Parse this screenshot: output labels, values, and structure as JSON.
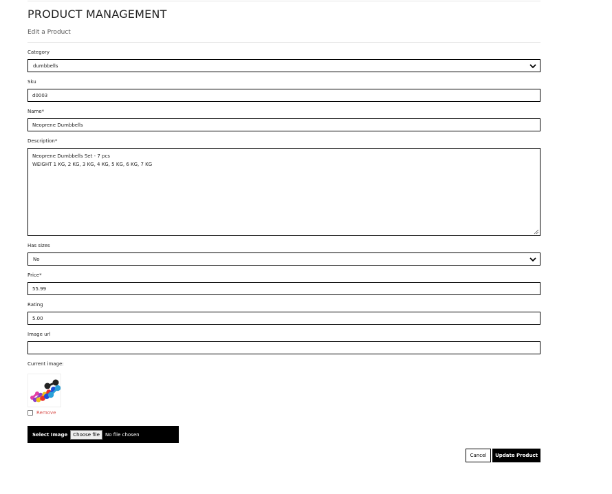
{
  "page": {
    "title": "PRODUCT MANAGEMENT",
    "subtitle": "Edit a Product"
  },
  "form": {
    "category": {
      "label": "Category",
      "value": "dumbbells"
    },
    "sku": {
      "label": "Sku",
      "value": "d0003"
    },
    "name": {
      "label": "Name*",
      "value": "Neoprene Dumbbells"
    },
    "description": {
      "label": "Description*",
      "line1": "Neoprene Dumbbells Set - 7 pcs",
      "line2": "WEIGHT 1 KG, 2 KG, 3 KG, 4 KG, 5 KG, 6 KG, 7 KG"
    },
    "has_sizes": {
      "label": "Has sizes",
      "value": "No"
    },
    "price": {
      "label": "Price*",
      "value": "55.99"
    },
    "rating": {
      "label": "Rating",
      "value": "5.00"
    },
    "image_url": {
      "label": "Image url",
      "value": ""
    },
    "current_image": {
      "label": "Current image:",
      "remove_label": "Remove"
    },
    "file_input": {
      "label": "Select Image",
      "button_label": "Choose file",
      "status": "No file chosen"
    }
  },
  "actions": {
    "cancel_label": "Cancel",
    "update_label": "Update Product"
  },
  "colors": {
    "accent": "#000000",
    "remove": "#d9534f",
    "dumbbells": [
      "#1e4fd8",
      "#e8312d",
      "#f2c21b",
      "#8a3fc9",
      "#e23fa3",
      "#222222",
      "#2aa0d8"
    ]
  },
  "icons": {
    "select_chevron": "chevron-down-icon",
    "resize": "resize-handle-icon"
  }
}
